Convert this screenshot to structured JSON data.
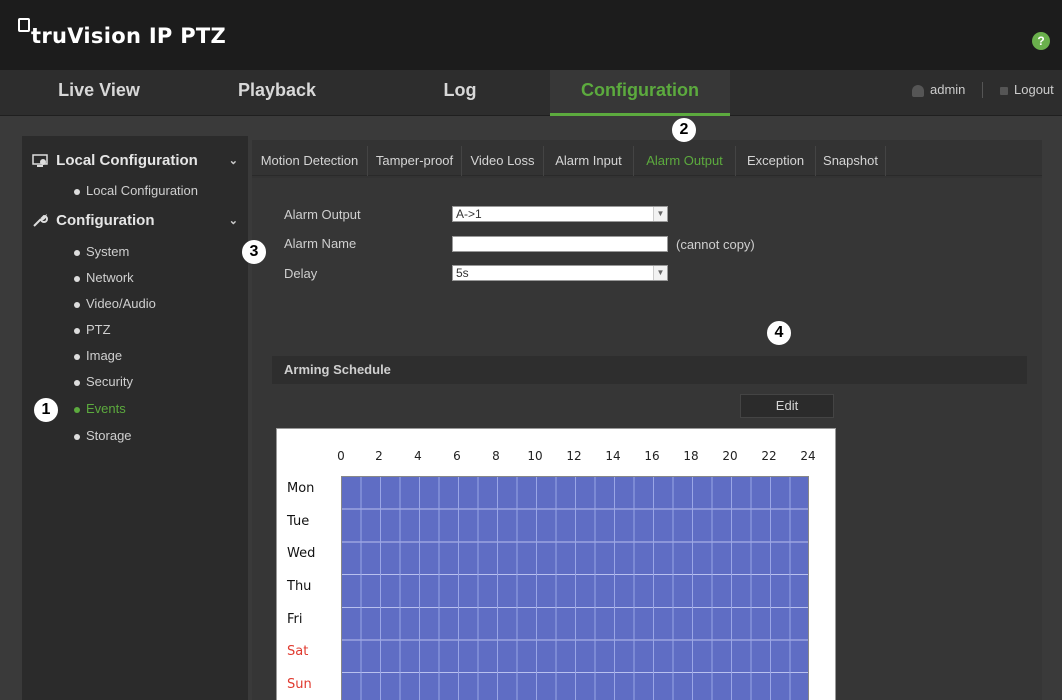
{
  "app": {
    "logo": "truVision IP PTZ",
    "help_icon": "?"
  },
  "nav": {
    "tabs": [
      {
        "label": "Live View"
      },
      {
        "label": "Playback"
      },
      {
        "label": "Log"
      },
      {
        "label": "Configuration",
        "active": true
      }
    ],
    "user": "admin",
    "logout": "Logout"
  },
  "callouts": [
    "1",
    "2",
    "3",
    "4"
  ],
  "sidebar": {
    "local_section": "Local Configuration",
    "local_items": [
      {
        "label": "Local Configuration"
      }
    ],
    "config_section": "Configuration",
    "config_items": [
      {
        "label": "System"
      },
      {
        "label": "Network"
      },
      {
        "label": "Video/Audio"
      },
      {
        "label": "PTZ"
      },
      {
        "label": "Image"
      },
      {
        "label": "Security"
      },
      {
        "label": "Events",
        "active": true
      },
      {
        "label": "Storage"
      }
    ]
  },
  "subtabs": [
    {
      "label": "Motion Detection"
    },
    {
      "label": "Tamper-proof"
    },
    {
      "label": "Video Loss"
    },
    {
      "label": "Alarm Input"
    },
    {
      "label": "Alarm Output",
      "active": true
    },
    {
      "label": "Exception"
    },
    {
      "label": "Snapshot"
    }
  ],
  "form": {
    "alarm_output_label": "Alarm Output",
    "alarm_output_value": "A->1",
    "alarm_name_label": "Alarm Name",
    "alarm_name_value": "",
    "alarm_name_hint": "(cannot copy)",
    "delay_label": "Delay",
    "delay_value": "5s"
  },
  "schedule": {
    "title": "Arming Schedule",
    "edit_label": "Edit",
    "hours": [
      "0",
      "2",
      "4",
      "6",
      "8",
      "10",
      "12",
      "14",
      "16",
      "18",
      "20",
      "22",
      "24"
    ],
    "days": [
      "Mon",
      "Tue",
      "Wed",
      "Thu",
      "Fri",
      "Sat",
      "Sun"
    ],
    "fill_color": "#5f6dc4",
    "weekend_color": "#e03a2f"
  },
  "colors": {
    "accent": "#5caa3e",
    "header_bg": "#1c1c1c",
    "panel_bg": "#363636"
  }
}
